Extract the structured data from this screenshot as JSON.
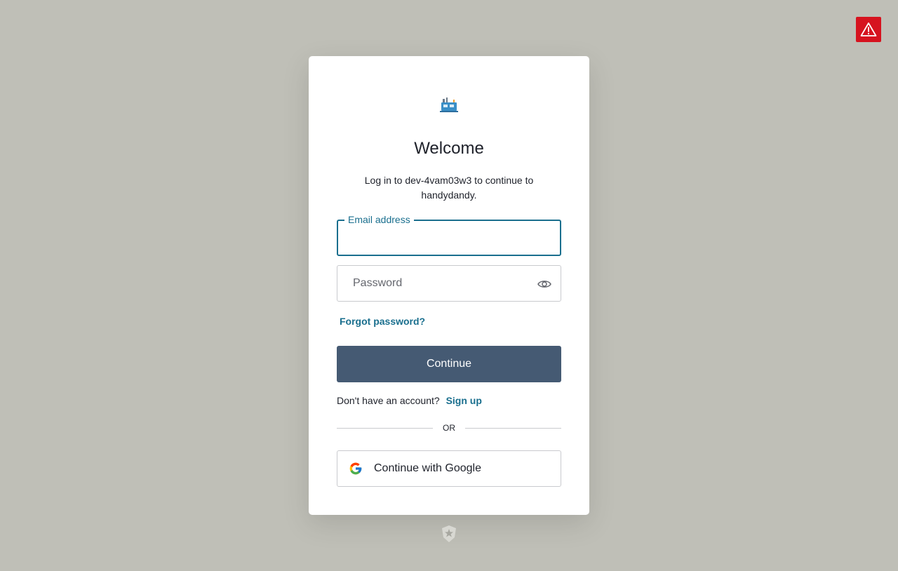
{
  "header": {
    "alert_icon": "warning-triangle-icon",
    "alert_color": "#d6131f"
  },
  "card": {
    "logo_icon": "app-logo-icon",
    "title": "Welcome",
    "subtitle": "Log in to dev-4vam03w3 to continue to handydandy.",
    "email": {
      "label": "Email address",
      "value": ""
    },
    "password": {
      "placeholder": "Password",
      "value": "",
      "toggle_icon": "eye-icon"
    },
    "forgot_password_label": "Forgot password?",
    "continue_label": "Continue",
    "signup_prompt": "Don't have an account?",
    "signup_label": "Sign up",
    "divider_label": "OR",
    "google_label": "Continue with Google",
    "google_icon": "google-icon"
  },
  "footer": {
    "badge_icon": "auth0-shield-icon"
  },
  "colors": {
    "background": "#bfbfb7",
    "accent": "#1a6f8e",
    "primary_button": "#455a73",
    "text": "#1e212a"
  }
}
